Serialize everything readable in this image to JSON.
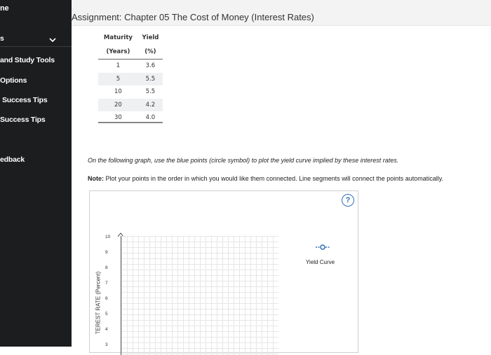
{
  "sidebar": {
    "items": [
      {
        "label": "ne"
      },
      {
        "label": "s"
      },
      {
        "label": "and Study Tools"
      },
      {
        "label": "Options"
      },
      {
        "label": "Success Tips"
      },
      {
        "label": "Success Tips"
      },
      {
        "label": "edback"
      }
    ]
  },
  "assignment": {
    "title": "Assignment: Chapter 05 The Cost of Money (Interest Rates)"
  },
  "yield_table": {
    "headers": [
      [
        "Maturity",
        "(Years)"
      ],
      [
        "Yield",
        "(%)"
      ]
    ],
    "rows": [
      {
        "maturity": "1",
        "yield": "3.6"
      },
      {
        "maturity": "5",
        "yield": "5.5"
      },
      {
        "maturity": "10",
        "yield": "5.5"
      },
      {
        "maturity": "20",
        "yield": "4.2"
      },
      {
        "maturity": "30",
        "yield": "4.0"
      }
    ]
  },
  "instructions": "On the following graph, use the blue points (circle symbol) to plot the yield curve implied by these interest rates.",
  "note": {
    "label": "Note:",
    "text": " Plot your points in the order in which you would like them connected. Line segments will connect the points automatically."
  },
  "graph": {
    "help_label": "?",
    "ylabel": "TEREST RATE (Percent)",
    "yticks": [
      "10",
      "9",
      "8",
      "7",
      "6",
      "5",
      "4",
      "3"
    ],
    "legend_label": "Yield Curve"
  },
  "colors": {
    "sidebar_bg": "#1c1d1f",
    "accent_blue": "#2f6fb5"
  }
}
